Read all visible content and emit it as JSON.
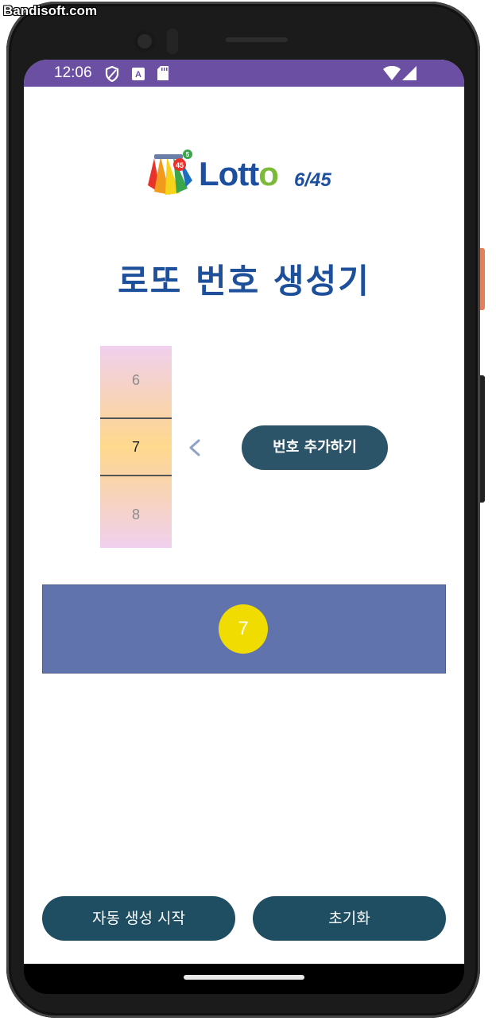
{
  "watermark": "Bandisoft.com",
  "status_bar": {
    "time": "12:06",
    "icons": [
      "shield-icon",
      "a-badge-icon",
      "sd-card-icon",
      "wifi-icon",
      "signal-icon"
    ]
  },
  "logo": {
    "brand": "Lotto",
    "suffix": "6/45",
    "ball_number": "45",
    "ball_small": "5"
  },
  "title": "로또 번호 생성기",
  "picker": {
    "prev": "6",
    "selected": "7",
    "next": "8"
  },
  "add_button_label": "번호 추가하기",
  "result": {
    "numbers": [
      "7"
    ]
  },
  "bottom": {
    "auto_label": "자동 생성 시작",
    "reset_label": "초기화"
  },
  "colors": {
    "status_bar": "#6b4fa3",
    "title": "#1d4f9a",
    "button": "#2c5468",
    "panel": "#6073ad",
    "ball": "#f0dc00"
  }
}
